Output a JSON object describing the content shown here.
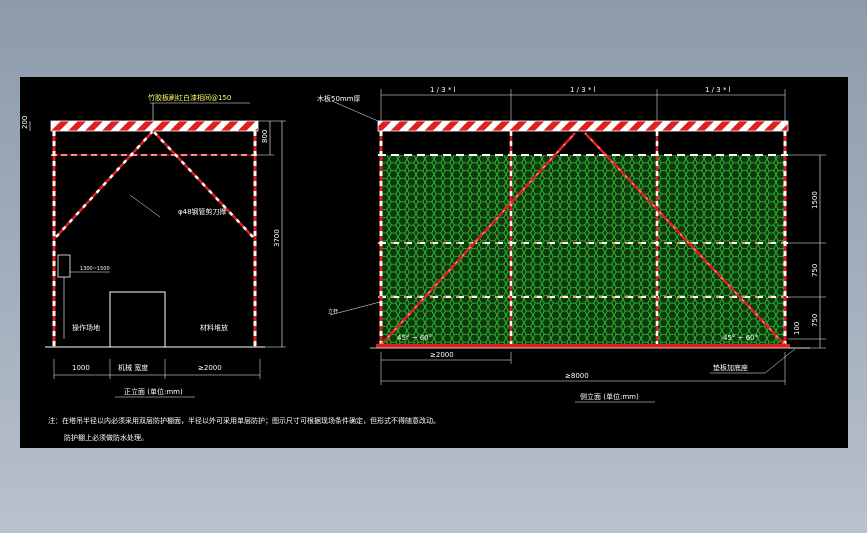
{
  "front_view": {
    "top_note": "竹胶板刷红白漆相间@150",
    "pipe_note": "φ48钢管剪刀撑",
    "dim_top": "200",
    "dim_right_top": "800",
    "dim_right_total": "3700",
    "small_dim": "1300~1500",
    "label_left": "操作场地",
    "label_right": "材料堆放",
    "dim_bottom_1": "1000",
    "dim_bottom_2": "机械 宽度",
    "dim_bottom_3": "≥2000",
    "caption": "正立面 (单位:mm)"
  },
  "side_view": {
    "top_note": "木板50mm厚",
    "thirds": [
      "1 / 3 * l",
      "1 / 3 * l",
      "1 / 3 * l"
    ],
    "dim_r1": "1500",
    "dim_r2": "750",
    "dim_r3": "750",
    "dim_r4": "100",
    "left_note": "立杆",
    "angle_left": "45° ~ 60°",
    "angle_right": "45° ~ 60°",
    "dim_2000": "≥2000",
    "dim_8000": "≥8000",
    "base_note": "垫板加底座",
    "caption": "侧立面 (单位:mm)"
  },
  "notes": {
    "line1": "注：在塔吊半径以内必须采用双层防护棚面，半径以外可采用单层防护；图示尺寸可根据现场条件确定，但形式不得随意改动。",
    "line2": "防护棚上必须做防水处理。"
  },
  "colors": {
    "background": "#000000",
    "red": "#e02020",
    "white": "#ffffff",
    "mesh": "#22b022",
    "dimension": "#ffffff"
  }
}
